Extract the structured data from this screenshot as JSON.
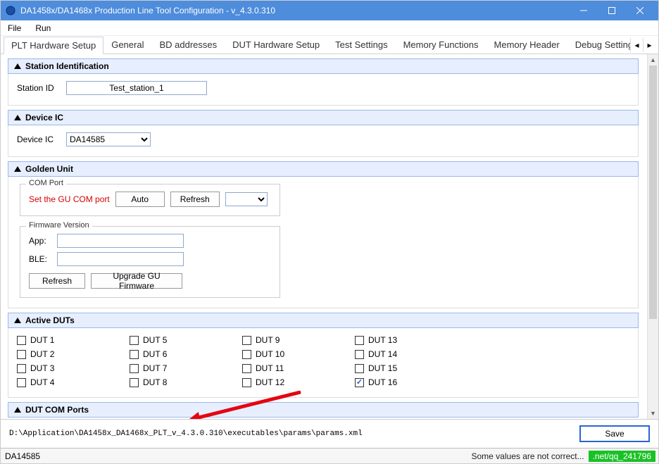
{
  "titlebar": {
    "title": "DA1458x/DA1468x Production Line Tool Configuration - v_4.3.0.310"
  },
  "menu": {
    "file": "File",
    "run": "Run"
  },
  "tabs": {
    "items": [
      "PLT Hardware Setup",
      "General",
      "BD addresses",
      "DUT Hardware Setup",
      "Test Settings",
      "Memory Functions",
      "Memory Header",
      "Debug Settings"
    ],
    "active_index": 0
  },
  "sections": {
    "station": {
      "header": "Station Identification",
      "label": "Station ID",
      "value": "Test_station_1"
    },
    "deviceic": {
      "header": "Device IC",
      "label": "Device IC",
      "value": "DA14585"
    },
    "golden": {
      "header": "Golden Unit",
      "comport": {
        "legend": "COM Port",
        "warn": "Set the GU COM port",
        "auto": "Auto",
        "refresh": "Refresh",
        "selected": ""
      },
      "fw": {
        "legend": "Firmware Version",
        "app_label": "App:",
        "ble_label": "BLE:",
        "app": "",
        "ble": "",
        "refresh": "Refresh",
        "upgrade": "Upgrade GU Firmware"
      }
    },
    "activeduts": {
      "header": "Active DUTs",
      "items": [
        {
          "label": "DUT 1",
          "checked": false
        },
        {
          "label": "DUT 2",
          "checked": false
        },
        {
          "label": "DUT 3",
          "checked": false
        },
        {
          "label": "DUT 4",
          "checked": false
        },
        {
          "label": "DUT 5",
          "checked": false
        },
        {
          "label": "DUT 6",
          "checked": false
        },
        {
          "label": "DUT 7",
          "checked": false
        },
        {
          "label": "DUT 8",
          "checked": false
        },
        {
          "label": "DUT 9",
          "checked": false
        },
        {
          "label": "DUT 10",
          "checked": false
        },
        {
          "label": "DUT 11",
          "checked": false
        },
        {
          "label": "DUT 12",
          "checked": false
        },
        {
          "label": "DUT 13",
          "checked": false
        },
        {
          "label": "DUT 14",
          "checked": false
        },
        {
          "label": "DUT 15",
          "checked": false
        },
        {
          "label": "DUT 16",
          "checked": true
        }
      ]
    },
    "dutcom": {
      "header": "DUT COM Ports"
    }
  },
  "footer": {
    "path": "D:\\Application\\DA1458x_DA1468x_PLT_v_4.3.0.310\\executables\\params\\params.xml",
    "save": "Save"
  },
  "status": {
    "left": "DA14585",
    "right": "Some values are not correct...",
    "watermark": ".net/qq_241796"
  }
}
